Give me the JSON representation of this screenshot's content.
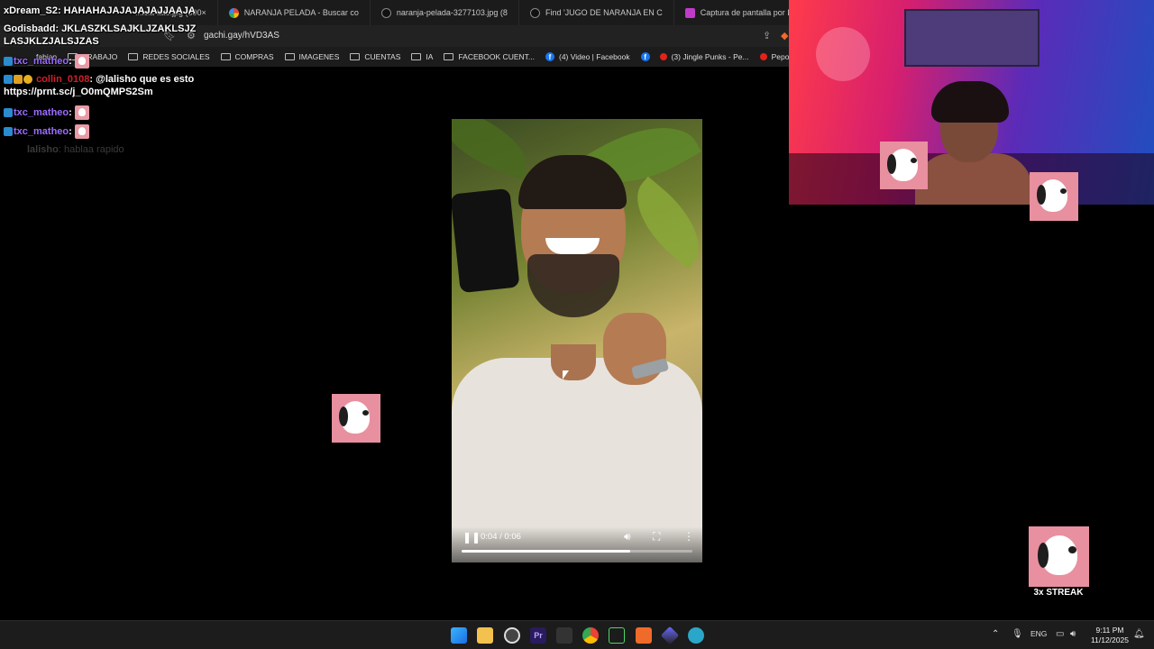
{
  "browser": {
    "tabs": [
      {
        "label": "...icia-late.jpg (600×"
      },
      {
        "label": "NARANJA PELADA - Buscar co"
      },
      {
        "label": "naranja-pelada-3277103.jpg (8"
      },
      {
        "label": "Find 'JUGO DE NARANJA EN C"
      },
      {
        "label": "Captura de pantalla por Lights"
      }
    ],
    "url": "gachi.gay/hVD3AS",
    "bookmarks": [
      {
        "label": "fabian"
      },
      {
        "label": "TRABAJO"
      },
      {
        "label": "REDES SOCIALES"
      },
      {
        "label": "COMPRAS"
      },
      {
        "label": "IMAGENES"
      },
      {
        "label": "CUENTAS"
      },
      {
        "label": "IA"
      },
      {
        "label": "FACEBOOK CUENT..."
      },
      {
        "label": "(4) Video | Facebook"
      },
      {
        "label": "(3) Jingle Punks - Pe..."
      },
      {
        "label": "Pepo x @kazu.oficia..."
      }
    ]
  },
  "chat": {
    "messages": [
      {
        "user": "xDream_S2",
        "text": "HAHAHAJAJAJAJAJJAAJA",
        "user_color": "#ffffff"
      },
      {
        "user": "Godisbadd",
        "text": "JKLASZKLSAJKLJZAKLSJZ LASJKLZJALSJZAS",
        "user_color": "#ffffff"
      },
      {
        "user": "txc_matheo",
        "text": "",
        "user_color": "#9b6cff"
      },
      {
        "user": "collin_0108",
        "text": "@lalisho que es esto https://prnt.sc/j_O0mQMPS2Sm",
        "user_color": "#d0202a"
      },
      {
        "user": "txc_matheo",
        "text": "",
        "user_color": "#9b6cff"
      },
      {
        "user": "txc_matheo",
        "text": "",
        "user_color": "#9b6cff"
      },
      {
        "user": "lalisho",
        "text": "hablaa rapido",
        "user_color": "#3a3a3a"
      }
    ]
  },
  "video": {
    "time": "0:04 / 0:06",
    "progress": 0.73,
    "play_icon": "pause-icon",
    "volume_icon": "volume-icon",
    "fullscreen_icon": "fullscreen-icon",
    "more_icon": "more-vert-icon"
  },
  "overlay": {
    "streak_label": "3x STREAK"
  },
  "taskbar": {
    "language": "ENG",
    "time": "9:11 PM",
    "date": "11/12/2025"
  },
  "colors": {
    "tab_bg": "#1b1b1b",
    "taskbar_bg": "#1c1c1c",
    "accent_pink": "#e8909f"
  }
}
